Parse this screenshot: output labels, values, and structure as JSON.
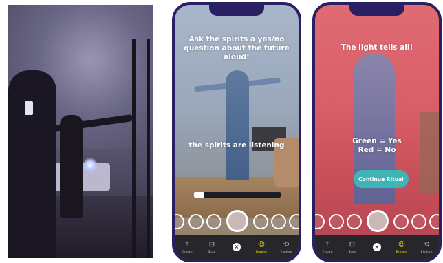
{
  "phone1": {
    "prompt": "Ask the spirits a yes/no question about the future aloud!",
    "status": "the spirits are listening",
    "progress": 0.12
  },
  "phone2": {
    "prompt": "The light tells all!",
    "answer_line1": "Green = Yes",
    "answer_line2": "Red = No",
    "continue_label": "Continue Ritual"
  },
  "tabbar": {
    "items": [
      {
        "label": "Create",
        "icon": "wand-icon"
      },
      {
        "label": "Scan",
        "icon": "scan-icon"
      },
      {
        "label": "",
        "icon": "close-icon"
      },
      {
        "label": "Browse",
        "icon": "smiley-icon"
      },
      {
        "label": "Explore",
        "icon": "explore-icon"
      }
    ],
    "active": "Browse"
  },
  "colors": {
    "phone_frame": "#2a1f63",
    "continue_button": "#3fb4b5",
    "active_tab": "#f2d40c",
    "tabbar_bg": "#26262b"
  }
}
